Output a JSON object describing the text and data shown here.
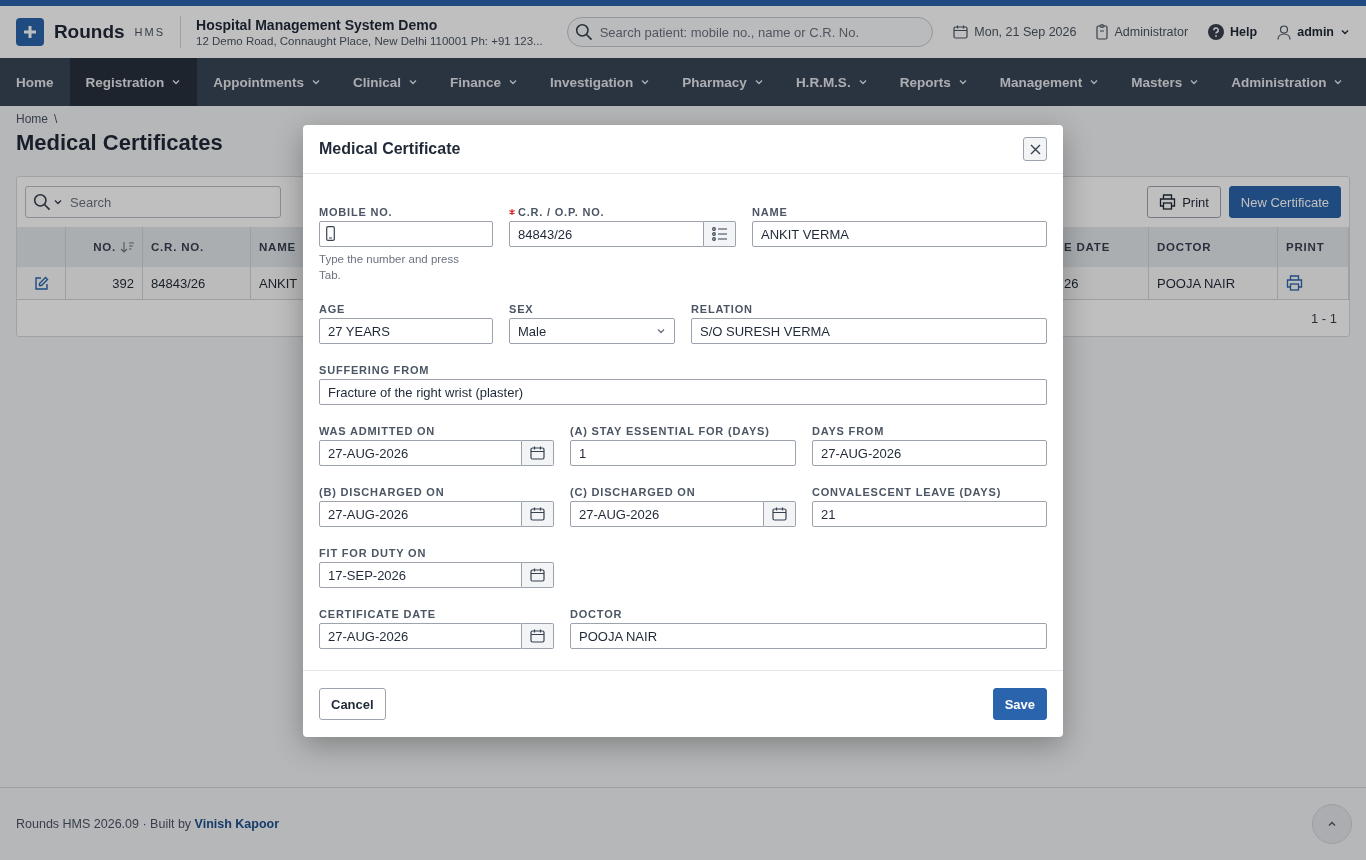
{
  "header": {
    "logo": "Rounds",
    "logo_sub": "HMS",
    "org_name": "Hospital Management System Demo",
    "org_address": "12 Demo Road, Connaught Place, New Delhi 110001 Ph: +91 123...",
    "search": {
      "placeholder": "Search patient: mobile no., name or C.R. No."
    },
    "date": "Mon, 21 Sep 2026",
    "role": "Administrator",
    "help": "Help",
    "user": "admin"
  },
  "nav": {
    "items": [
      {
        "label": "Home",
        "has_menu": false,
        "selected": false
      },
      {
        "label": "Registration",
        "has_menu": true,
        "selected": true
      },
      {
        "label": "Appointments",
        "has_menu": true,
        "selected": false
      },
      {
        "label": "Clinical",
        "has_menu": true,
        "selected": false
      },
      {
        "label": "Finance",
        "has_menu": true,
        "selected": false
      },
      {
        "label": "Investigation",
        "has_menu": true,
        "selected": false
      },
      {
        "label": "Pharmacy",
        "has_menu": true,
        "selected": false
      },
      {
        "label": "H.R.M.S.",
        "has_menu": true,
        "selected": false
      },
      {
        "label": "Reports",
        "has_menu": true,
        "selected": false
      },
      {
        "label": "Management",
        "has_menu": true,
        "selected": false
      },
      {
        "label": "Masters",
        "has_menu": true,
        "selected": false
      },
      {
        "label": "Administration",
        "has_menu": true,
        "selected": false
      }
    ]
  },
  "breadcrumb": {
    "items": [
      "Home"
    ],
    "separator": "\\"
  },
  "page_title": "Medical Certificates",
  "toolbar": {
    "search": {
      "placeholder": "Search"
    },
    "print_button": "Print",
    "new_button": "New Certificate"
  },
  "table": {
    "columns": [
      {
        "label": "NO.",
        "sorted": true
      },
      {
        "label": "C.R. NO.",
        "sorted": false
      },
      {
        "label": "NAME",
        "sorted": false
      },
      {
        "label": "E DATE",
        "sorted": false
      },
      {
        "label": "DOCTOR",
        "sorted": false
      },
      {
        "label": "PRINT",
        "sorted": false
      }
    ],
    "rows": [
      {
        "no": "392",
        "cr_no": "84843/26",
        "name": "ANKIT",
        "date": "26",
        "doctor": "POOJA NAIR"
      }
    ],
    "pager": "1 - 1"
  },
  "modal": {
    "title": "Medical Certificate",
    "rows": [
      [
        {
          "kind": "phone",
          "label": "MOBILE NO.",
          "required": false,
          "hint": "Type the number and press Tab."
        },
        {
          "kind": "lookup",
          "label": "C.R. / O.P. NO.",
          "value": "84843/26",
          "required": true
        },
        {
          "kind": "text",
          "label": "NAME",
          "value": "ANKIT VERMA",
          "required": false
        }
      ],
      [
        {
          "kind": "text",
          "label": "AGE",
          "value": "27 YEARS",
          "required": false
        },
        {
          "kind": "select",
          "label": "SEX",
          "value": "Male",
          "required": false
        },
        {
          "kind": "text",
          "label": "RELATION",
          "value": "S/O SURESH VERMA",
          "required": false
        }
      ],
      [
        {
          "kind": "text",
          "label": "SUFFERING FROM",
          "value": "Fracture of the right wrist (plaster)",
          "required": false
        }
      ],
      [
        {
          "kind": "date",
          "label": "WAS ADMITTED ON",
          "value": "27-AUG-2026",
          "required": false
        },
        {
          "kind": "text",
          "label": "(A) STAY ESSENTIAL FOR (DAYS)",
          "value": "1",
          "required": false
        },
        {
          "kind": "text",
          "label": "DAYS FROM",
          "value": "27-AUG-2026",
          "required": false
        }
      ],
      [
        {
          "kind": "date",
          "label": "(B) DISCHARGED ON",
          "value": "27-AUG-2026",
          "required": false
        },
        {
          "kind": "date",
          "label": "(C) DISCHARGED ON",
          "value": "27-AUG-2026",
          "required": false
        },
        {
          "kind": "text",
          "label": "CONVALESCENT LEAVE (DAYS)",
          "value": "21",
          "required": false
        }
      ],
      [
        {
          "kind": "date",
          "label": "FIT FOR DUTY ON",
          "value": "17-SEP-2026",
          "required": false
        }
      ],
      [
        {
          "kind": "date",
          "label": "CERTIFICATE DATE",
          "value": "27-AUG-2026",
          "required": false
        },
        {
          "kind": "text",
          "label": "DOCTOR",
          "value": "POOJA NAIR",
          "required": false
        }
      ]
    ],
    "cancel_button": "Cancel",
    "save_button": "Save"
  },
  "footer": {
    "text": "Rounds HMS 2026.09 · Built by ",
    "link": "Vinish Kapoor"
  }
}
